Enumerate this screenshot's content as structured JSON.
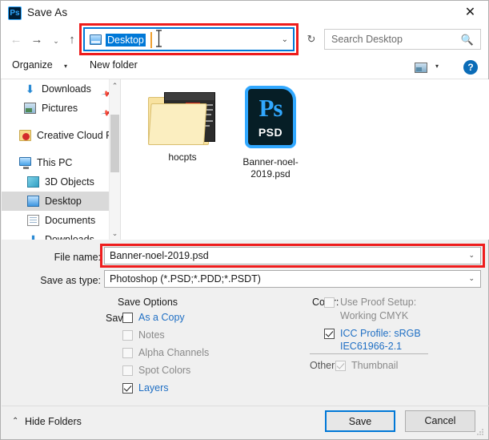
{
  "window": {
    "title": "Save As",
    "app_icon": "photoshop-icon",
    "close_label": "✕"
  },
  "nav": {
    "back": "←",
    "forward": "→",
    "history_chevron": "⌄",
    "up": "↑",
    "refresh": "↻"
  },
  "address": {
    "value": "Desktop",
    "dropdown": "⌄",
    "icon": "desktop-folder-icon"
  },
  "search": {
    "placeholder": "Search Desktop",
    "icon": "magnifier-icon"
  },
  "toolbar": {
    "organize": "Organize",
    "organize_arrow": "▾",
    "new_folder": "New folder",
    "view_arrow": "▾",
    "help": "?"
  },
  "sidebar": {
    "items": [
      {
        "label": "Downloads",
        "icon": "download-arrow-icon",
        "pinned": true,
        "selected": false
      },
      {
        "label": "Pictures",
        "icon": "picture-icon",
        "pinned": true,
        "selected": false
      },
      {
        "label": "Creative Cloud Fi",
        "icon": "creative-cloud-icon",
        "pinned": false,
        "selected": false
      },
      {
        "label": "This PC",
        "icon": "computer-icon",
        "pinned": false,
        "selected": false
      },
      {
        "label": "3D Objects",
        "icon": "cube-icon",
        "pinned": false,
        "selected": false
      },
      {
        "label": "Desktop",
        "icon": "desktop-icon",
        "pinned": false,
        "selected": true
      },
      {
        "label": "Documents",
        "icon": "document-icon",
        "pinned": false,
        "selected": false
      },
      {
        "label": "Downloads",
        "icon": "download-arrow-icon",
        "pinned": false,
        "selected": false
      }
    ],
    "scroll_up": "⌃",
    "scroll_down": "⌄"
  },
  "files": [
    {
      "name": "hocpts",
      "type": "folder"
    },
    {
      "name": "Banner-noel-2019.psd",
      "type": "psd",
      "badge_top": "Ps",
      "badge_bottom": "PSD"
    }
  ],
  "form": {
    "file_name_label": "File name:",
    "file_name_value": "Banner-noel-2019.psd",
    "save_type_label": "Save as type:",
    "save_type_value": "Photoshop (*.PSD;*.PDD;*.PSDT)",
    "dropdown_arrow": "⌄"
  },
  "save_options": {
    "title": "Save Options",
    "save_label": "Save:",
    "checkboxes": [
      {
        "label": "As a Copy",
        "checked": false,
        "enabled": true
      },
      {
        "label": "Notes",
        "checked": false,
        "enabled": false
      },
      {
        "label": "Alpha Channels",
        "checked": false,
        "enabled": false
      },
      {
        "label": "Spot Colors",
        "checked": false,
        "enabled": false
      },
      {
        "label": "Layers",
        "checked": true,
        "enabled": true
      }
    ]
  },
  "color_options": {
    "color_label": "Color:",
    "proof_setup": "Use Proof Setup:",
    "proof_value": "Working CMYK",
    "icc_profile": "ICC Profile:  sRGB",
    "icc_profile_line2": "IEC61966-2.1",
    "other_label": "Other:",
    "thumbnail": "Thumbnail"
  },
  "footer": {
    "hide_folders": "Hide Folders",
    "hide_chevron": "⌃",
    "save": "Save",
    "cancel": "Cancel"
  },
  "colors": {
    "accent": "#0078d7",
    "highlight_box": "#ee1c1c",
    "link_blue": "#1f6fc4",
    "disabled": "#8a8a8a"
  }
}
